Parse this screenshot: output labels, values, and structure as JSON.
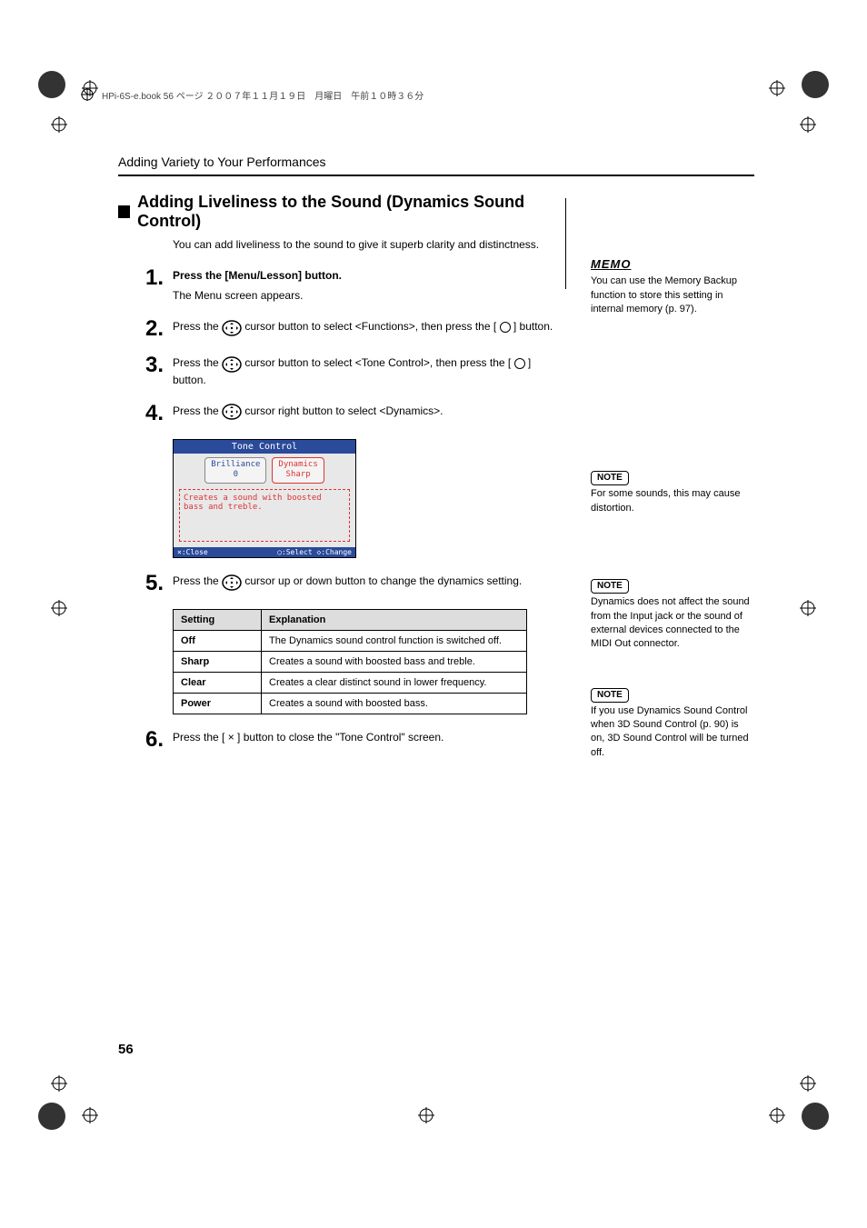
{
  "header_tag": "HPi-6S-e.book  56 ページ  ２００７年１１月１９日　月曜日　午前１０時３６分",
  "running_head": "Adding Variety to Your Performances",
  "section_title": "Adding Liveliness to the Sound (Dynamics Sound Control)",
  "intro": "You can add liveliness to the sound to give it superb clarity and distinctness.",
  "steps": {
    "s1_num": "1.",
    "s1_bold": "Press the [Menu/Lesson] button.",
    "s1_sub": "The Menu screen appears.",
    "s2_num": "2.",
    "s2_a": "Press the ",
    "s2_b": " cursor button to select <Functions>, then press the [ ",
    "s2_c": " ] button.",
    "s3_num": "3.",
    "s3_a": "Press the ",
    "s3_b": " cursor button to select <Tone Control>, then press the [ ",
    "s3_c": " ] button.",
    "s4_num": "4.",
    "s4_a": "Press the ",
    "s4_b": " cursor right button to select <Dynamics>.",
    "s5_num": "5.",
    "s5_a": "Press the ",
    "s5_b": " cursor up or down button to change the dynamics setting.",
    "s6_num": "6.",
    "s6_a": "Press the [ ",
    "s6_b": " ] button to close the \"Tone Control\" screen.",
    "x_sym": "×"
  },
  "lcd": {
    "title": "Tone Control",
    "tab1_name": "Brilliance",
    "tab1_val": "0",
    "tab2_name": "Dynamics",
    "tab2_val": "Sharp",
    "desc": "Creates a sound with boosted bass and treble.",
    "foot_left": "×:Close",
    "foot_right": "○:Select  ◇:Change"
  },
  "table": {
    "h1": "Setting",
    "h2": "Explanation",
    "r1k": "Off",
    "r1v": "The Dynamics sound control function is switched off.",
    "r2k": "Sharp",
    "r2v": "Creates a sound with boosted bass and treble.",
    "r3k": "Clear",
    "r3v": "Creates a clear distinct sound in lower frequency.",
    "r4k": "Power",
    "r4v": "Creates a sound with boosted bass."
  },
  "side": {
    "memo_label": "MEMO",
    "memo_text": "You can use the Memory Backup function to store this setting in internal memory (p. 97).",
    "note_label": "NOTE",
    "note1_text": "For some sounds, this may cause distortion.",
    "note2_text": "Dynamics does not affect the sound from the Input jack or the sound of external devices connected to the MIDI Out connector.",
    "note3_text": "If you use Dynamics Sound Control when 3D Sound Control (p. 90) is on, 3D Sound Control will be turned off."
  },
  "page_number": "56"
}
